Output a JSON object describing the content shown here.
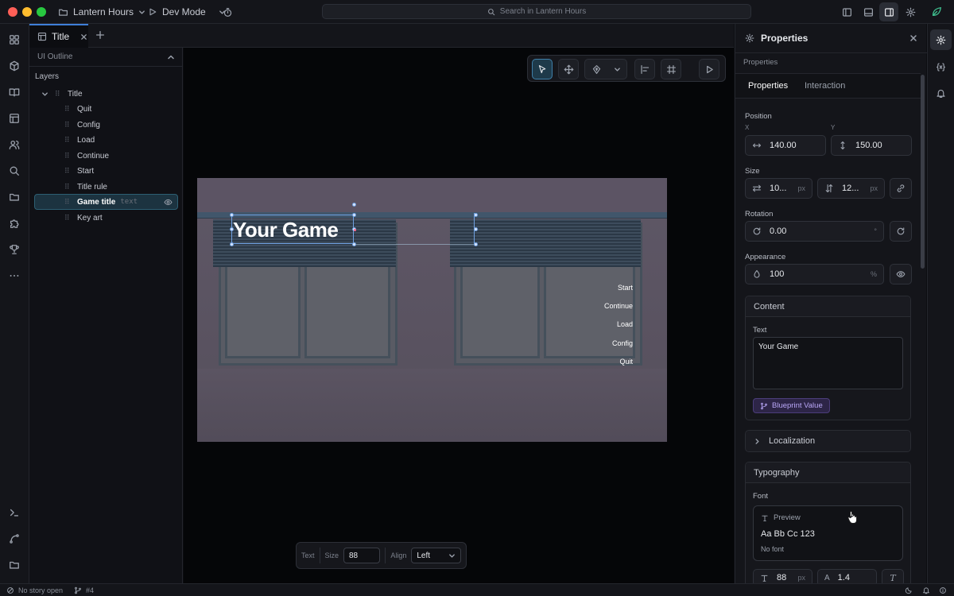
{
  "titlebar": {
    "project": "Lantern Hours",
    "mode": "Dev Mode",
    "search_placeholder": "Search in Lantern Hours"
  },
  "tabs": [
    {
      "label": "Title"
    }
  ],
  "outline": {
    "header": "UI Outline",
    "layers_label": "Layers",
    "root": "Title",
    "items": [
      {
        "label": "Quit"
      },
      {
        "label": "Config"
      },
      {
        "label": "Load"
      },
      {
        "label": "Continue"
      },
      {
        "label": "Start"
      },
      {
        "label": "Title rule"
      },
      {
        "label": "Game title",
        "type": "text",
        "selected": true
      },
      {
        "label": "Key art"
      }
    ]
  },
  "scene": {
    "title": "Your Game",
    "menu": [
      "Start",
      "Continue",
      "Load",
      "Config",
      "Quit"
    ]
  },
  "textbar": {
    "kind": "Text",
    "size_label": "Size",
    "size_value": "88",
    "align_label": "Align",
    "align_value": "Left"
  },
  "properties": {
    "title": "Properties",
    "breadcrumb": "Properties",
    "tabs": [
      "Properties",
      "Interaction"
    ],
    "active_tab": "Properties",
    "position": {
      "label": "Position",
      "x_label": "X",
      "y_label": "Y",
      "x": "140.00",
      "y": "150.00"
    },
    "size": {
      "label": "Size",
      "w": "10...",
      "h": "12...",
      "unit": "px"
    },
    "rotation": {
      "label": "Rotation",
      "value": "0.00",
      "unit": "°"
    },
    "appearance": {
      "label": "Appearance",
      "value": "100",
      "unit": "%"
    },
    "content": {
      "label": "Content",
      "text_label": "Text",
      "text_value": "Your Game",
      "blueprint_label": "Blueprint Value"
    },
    "localization": {
      "label": "Localization"
    },
    "typography": {
      "label": "Typography",
      "font_label": "Font",
      "preview_label": "Preview",
      "preview_sample": "Aa Bb Cc 123",
      "font_value": "No font",
      "font_size": "88",
      "line_height": "1.4",
      "size_unit": "px"
    }
  },
  "statusbar": {
    "story": "No story open",
    "branch": "#4"
  },
  "colors": {
    "accent": "#3f7fd8",
    "selection": "#2d5f73",
    "blueprint": "#a78bfa"
  }
}
